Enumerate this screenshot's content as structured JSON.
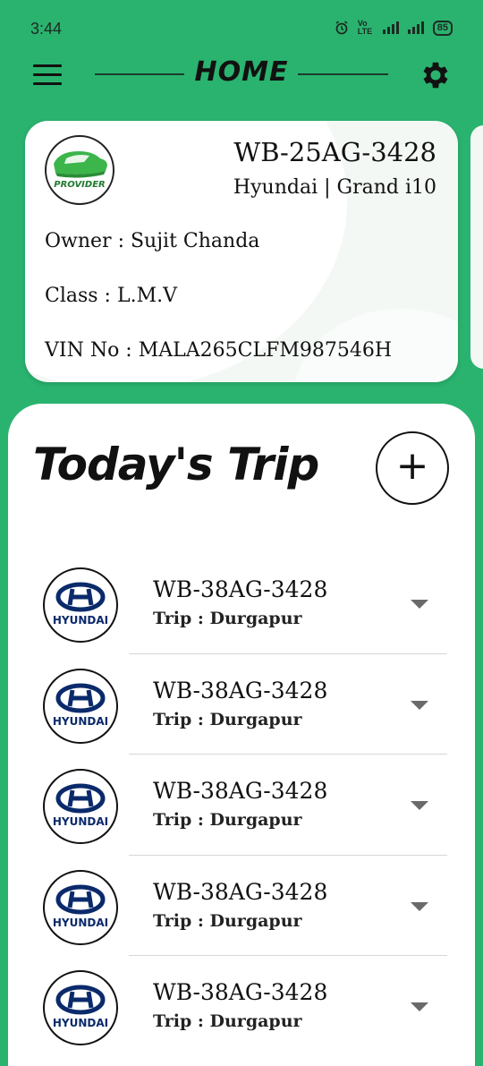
{
  "status_bar": {
    "time": "3:44",
    "network": "Vo LTE",
    "battery": "85"
  },
  "header": {
    "title": "HOME"
  },
  "vehicle_card": {
    "logo_text": "PROVIDER",
    "plate": "WB-25AG-3428",
    "model": "Hyundai | Grand i10",
    "owner": "Owner : Sujit Chanda",
    "class": "Class : L.M.V",
    "vin": "VIN No : MALA265CLFM987546H"
  },
  "trips_section": {
    "title": "Today's Trip",
    "add_label": "+"
  },
  "trips": [
    {
      "logo_text": "HYUNDAI",
      "plate": "WB-38AG-3428",
      "destination": "Trip : Durgapur"
    },
    {
      "logo_text": "HYUNDAI",
      "plate": "WB-38AG-3428",
      "destination": "Trip : Durgapur"
    },
    {
      "logo_text": "HYUNDAI",
      "plate": "WB-38AG-3428",
      "destination": "Trip : Durgapur"
    },
    {
      "logo_text": "HYUNDAI",
      "plate": "WB-38AG-3428",
      "destination": "Trip : Durgapur"
    },
    {
      "logo_text": "HYUNDAI",
      "plate": "WB-38AG-3428",
      "destination": "Trip : Durgapur"
    }
  ],
  "colors": {
    "accent": "#2ab36f",
    "hyundai_blue": "#0b2a6b"
  },
  "icons": {
    "menu": "hamburger-menu-icon",
    "settings": "gear-icon",
    "expand": "chevron-down-icon"
  }
}
